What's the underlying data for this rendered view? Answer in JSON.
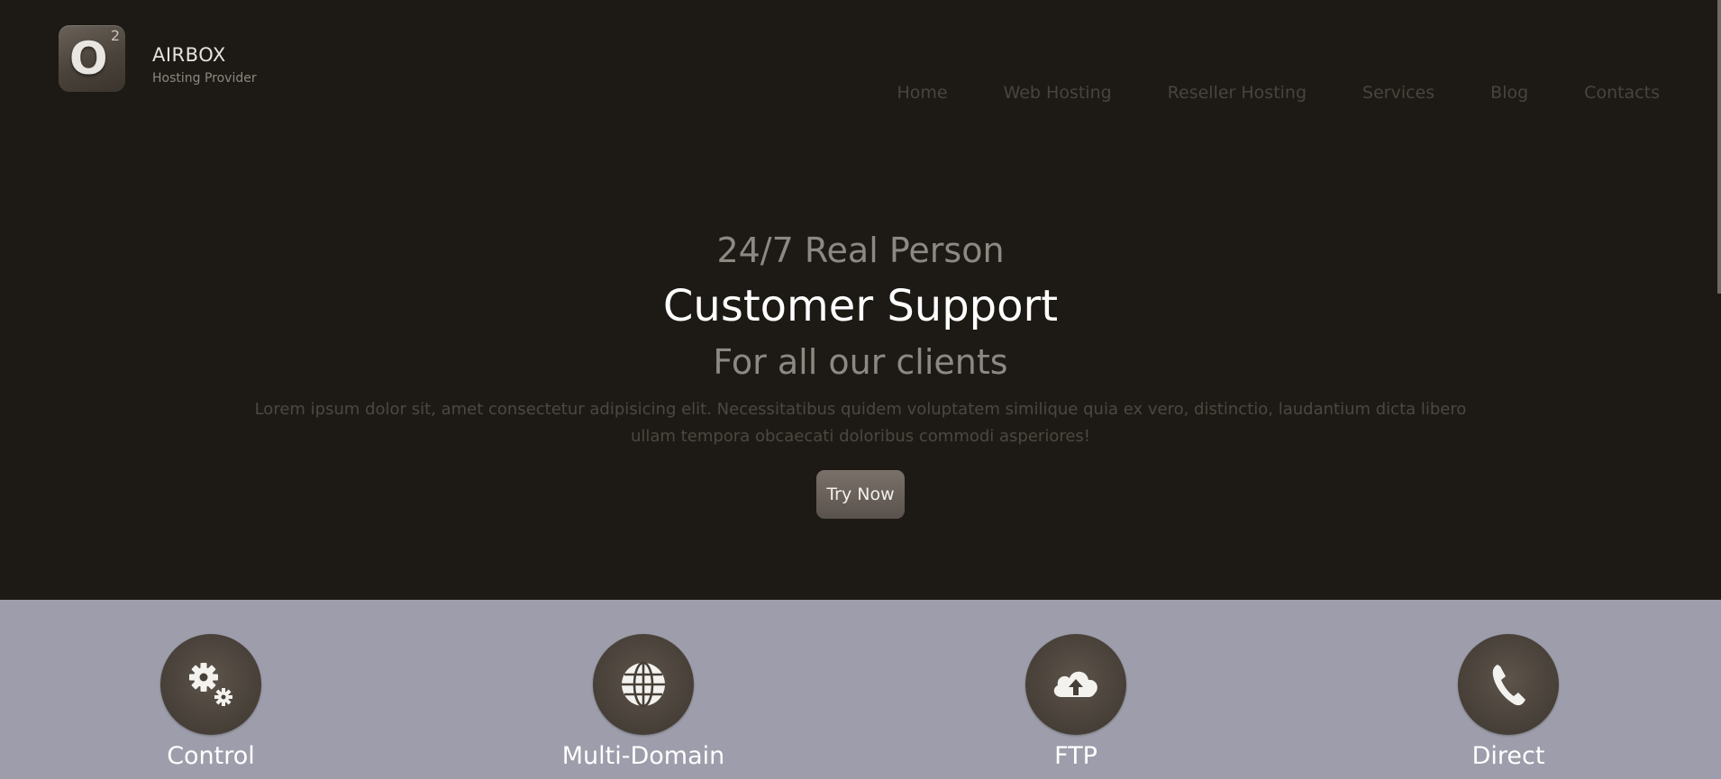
{
  "brand": {
    "name": "AIRBOX",
    "tagline": "Hosting Provider",
    "logo_letter": "O",
    "logo_superscript": "2"
  },
  "nav": {
    "items": [
      "Home",
      "Web Hosting",
      "Reseller Hosting",
      "Services",
      "Blog",
      "Contacts"
    ]
  },
  "hero": {
    "line1": "24/7 Real Person",
    "line2": "Customer Support",
    "line3": "For all our clients",
    "text": "Lorem ipsum dolor sit, amet consectetur adipisicing elit. Necessitatibus quidem voluptatem similique quia ex vero, distinctio, laudantium dicta libero ullam tempora obcaecati doloribus commodi asperiores!",
    "button_label": "Try Now"
  },
  "features": [
    {
      "title": "Control",
      "subtitle": "",
      "icon": "gears-icon"
    },
    {
      "title": "Multi-Domain",
      "subtitle": "",
      "icon": "globe-icon"
    },
    {
      "title": "FTP",
      "subtitle": "",
      "icon": "cloud-upload-icon"
    },
    {
      "title": "Direct",
      "subtitle": "",
      "icon": "phone-icon"
    }
  ],
  "colors": {
    "background": "#1d1a15",
    "features_band": "#9e9dab",
    "icon_circle": "#463f37",
    "button": "#6a625b"
  }
}
